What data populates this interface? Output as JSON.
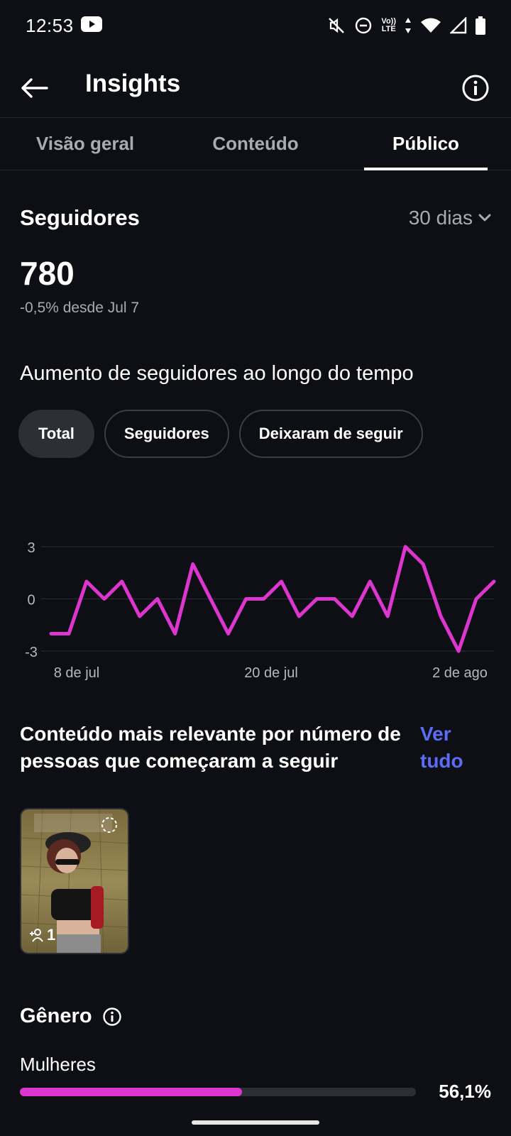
{
  "status": {
    "time": "12:53",
    "network": "LTE"
  },
  "header": {
    "title": "Insights"
  },
  "tabs": [
    {
      "label": "Visão geral"
    },
    {
      "label": "Conteúdo"
    },
    {
      "label": "Público"
    }
  ],
  "followers": {
    "title": "Seguidores",
    "period": "30 dias",
    "count": "780",
    "delta": "-0,5% desde Jul 7"
  },
  "growth": {
    "title": "Aumento de seguidores ao longo do tempo",
    "chips": [
      "Total",
      "Seguidores",
      "Deixaram de seguir"
    ]
  },
  "chart_data": {
    "type": "line",
    "x_ticks": [
      "8 de jul",
      "20 de jul",
      "2 de ago"
    ],
    "y_ticks": [
      "3",
      "0",
      "-3"
    ],
    "ylim": [
      -3,
      3
    ],
    "color": "#dc36cf",
    "values": [
      -2,
      -2,
      1,
      0,
      1,
      -1,
      0,
      -2,
      2,
      0,
      -2,
      0,
      0,
      1,
      -1,
      0,
      0,
      -1,
      1,
      -1,
      3,
      2,
      -1,
      -3,
      0,
      1
    ]
  },
  "top_content": {
    "title": "Conteúdo mais relevante por número de pessoas que começaram a seguir",
    "see_all": "Ver tudo",
    "items": [
      {
        "count": "1"
      }
    ]
  },
  "gender": {
    "title": "Gênero",
    "rows": [
      {
        "label": "Mulheres",
        "percent": "56,1%",
        "fraction": 0.561
      }
    ]
  },
  "colors": {
    "accent": "#dc36cf",
    "link": "#5b6cf5",
    "background": "#0e0f14"
  }
}
